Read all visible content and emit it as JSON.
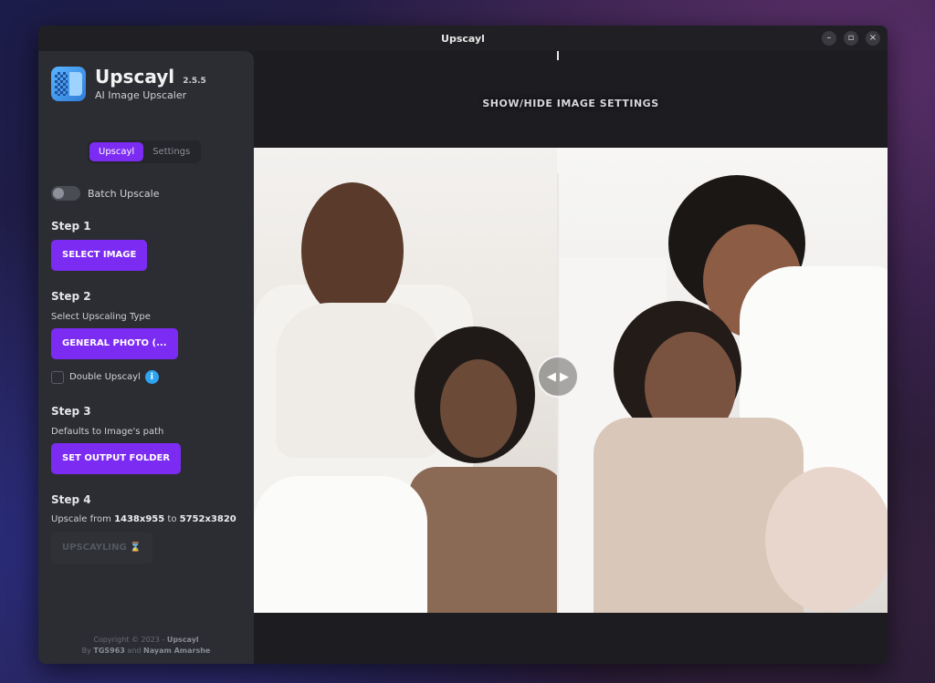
{
  "window": {
    "title": "Upscayl",
    "controls": {
      "minimize": "–",
      "maximize": "▫",
      "close": "×"
    }
  },
  "sidebar": {
    "brand": {
      "name": "Upscayl",
      "version": "2.5.5",
      "subtitle": "AI Image Upscaler"
    },
    "tabs": [
      {
        "label": "Upscayl",
        "active": true
      },
      {
        "label": "Settings",
        "active": false
      }
    ],
    "batch_toggle": {
      "label": "Batch Upscale",
      "on": false
    },
    "step1": {
      "title": "Step 1",
      "button": "SELECT IMAGE"
    },
    "step2": {
      "title": "Step 2",
      "desc": "Select Upscaling Type",
      "button": "GENERAL PHOTO (...",
      "double_label": "Double Upscayl",
      "info_icon": "i"
    },
    "step3": {
      "title": "Step 3",
      "desc": "Defaults to Image's path",
      "button": "SET OUTPUT FOLDER"
    },
    "step4": {
      "title": "Step 4",
      "desc_prefix": "Upscale from ",
      "from": "1438x955",
      "to_word": " to ",
      "to": "5752x3820",
      "button": "UPSCAYLING ⌛"
    },
    "footer": {
      "line1_prefix": "Copyright © 2023 - ",
      "line1_name": "Upscayl",
      "line2_by": "By ",
      "line2_a": "TGS963",
      "line2_and": " and ",
      "line2_b": "Nayam Amarshe"
    }
  },
  "main": {
    "settings_toggle": "SHOW/HIDE IMAGE SETTINGS",
    "slider_handle": "◀ ▶",
    "slider_position": 0.48
  },
  "colors": {
    "accent": "#7c2cf2",
    "sidebar_bg": "#2b2d33",
    "main_bg": "#1d1d21",
    "info": "#2ea3f2"
  }
}
